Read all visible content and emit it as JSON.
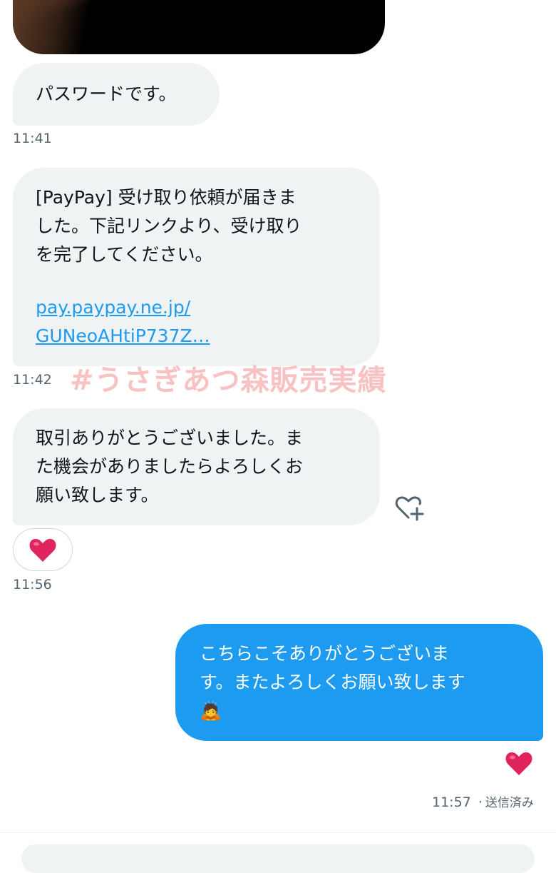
{
  "messages": {
    "m1": {
      "text": "パスワードです。",
      "time": "11:41"
    },
    "m2": {
      "lines": [
        "[PayPay] 受け取り依頼が届きま",
        "した。下記リンクより、受け取り",
        "を完了してください。"
      ],
      "link_lines": [
        "pay.paypay.ne.jp/",
        "GUNeoAHtiP737Z…"
      ],
      "time": "11:42"
    },
    "m3": {
      "lines": [
        "取引ありがとうございました。ま",
        "た機会がありましたらよろしくお",
        "願い致します。"
      ],
      "reaction": "heart-emoji",
      "time": "11:56"
    },
    "m4": {
      "lines": [
        "こちらこそありがとうございま",
        "す。またよろしくお願い致します"
      ],
      "emoji": "🙇",
      "reaction": "heart-emoji",
      "time": "11:57",
      "status": "送信済み"
    }
  },
  "watermark": "#うさぎあつ森販売実績",
  "icons": [
    "add-reaction-icon",
    "heart-emoji"
  ],
  "colors": {
    "incoming_bubble": "#eff3f4",
    "outgoing_bubble": "#1d9bf0",
    "link": "#1d9bf0",
    "heart": "#e0245e",
    "timestamp": "#536471",
    "watermark": "#f07878"
  }
}
